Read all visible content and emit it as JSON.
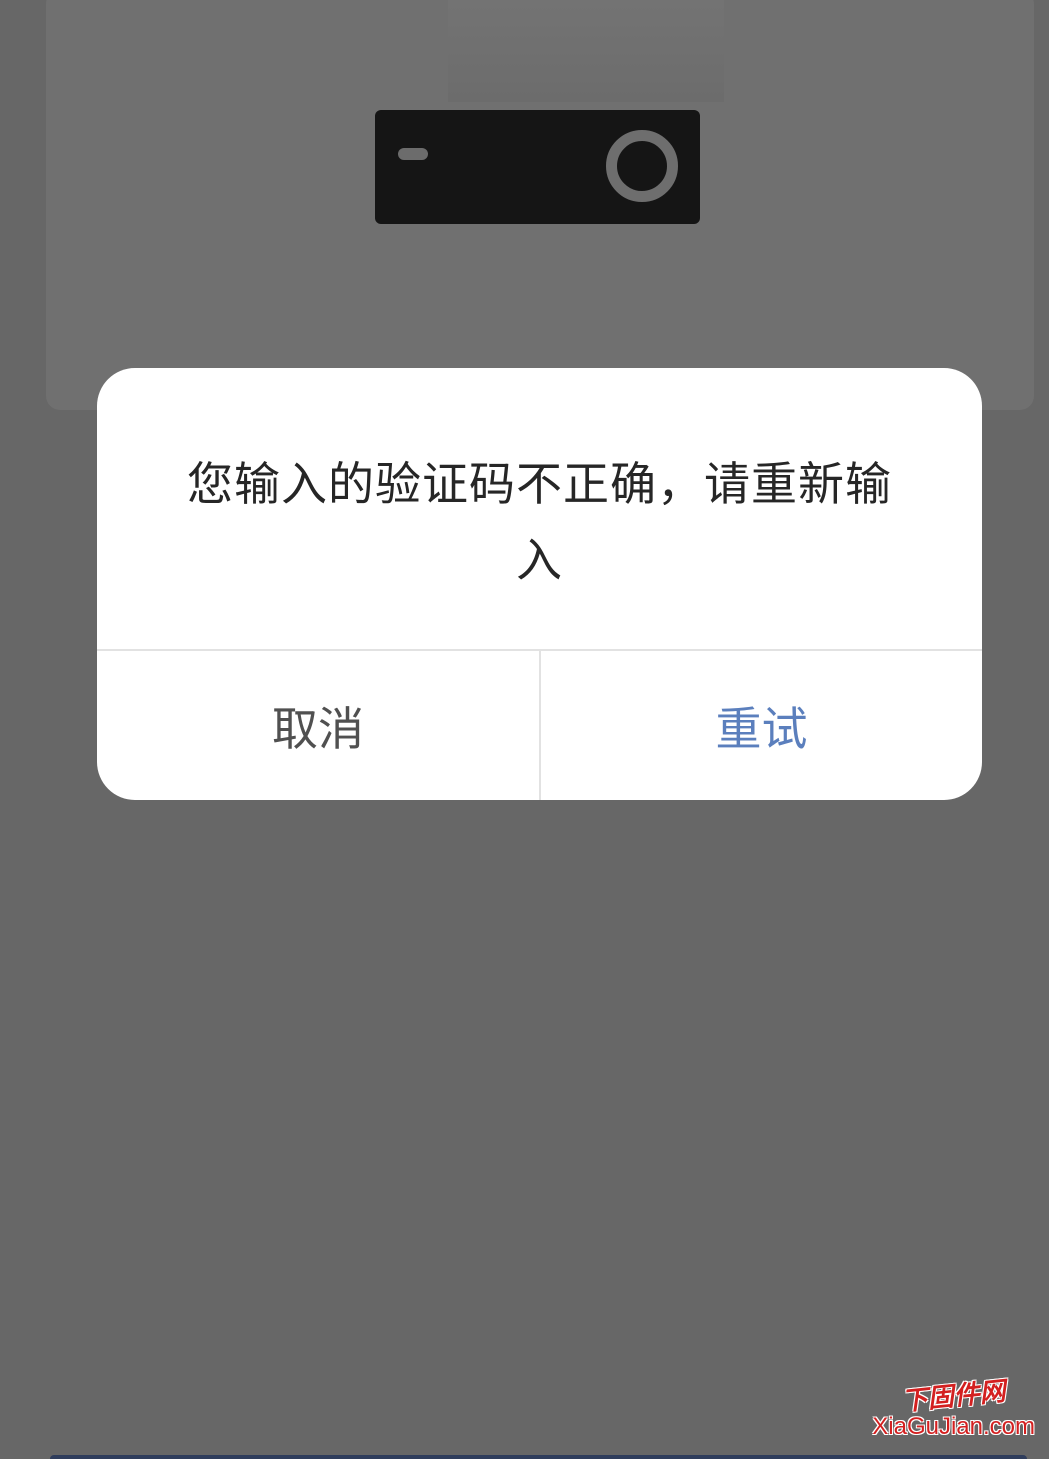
{
  "dialog": {
    "message": "您输入的验证码不正确，请重新输入",
    "cancel_label": "取消",
    "retry_label": "重试"
  },
  "watermark": {
    "cn_text": "下固件网",
    "en_text": "XiaGuJian.com"
  },
  "colors": {
    "overlay": "#676767",
    "dialog_bg": "#ffffff",
    "primary_action": "#5b7fbd",
    "secondary_action": "#505050"
  },
  "icons": {
    "device_illustration": "camera-device-icon"
  }
}
